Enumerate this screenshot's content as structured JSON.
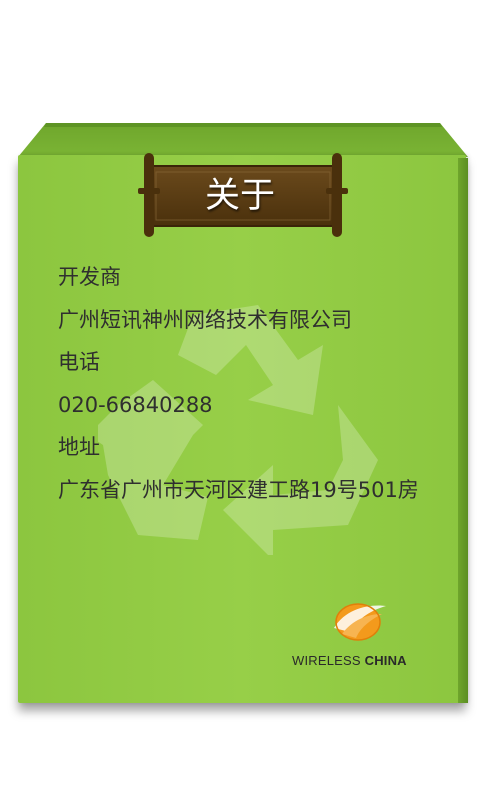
{
  "header": {
    "title": "关于"
  },
  "about": {
    "developer_label": "开发商",
    "developer_value": "广州短讯神州网络技术有限公司",
    "phone_label": "电话",
    "phone_value": "020-66840288",
    "address_label": "地址",
    "address_value": "广东省广州市天河区建工路19号501房"
  },
  "brand": {
    "name_light": "WIRELESS",
    "name_bold": "CHINA"
  },
  "colors": {
    "card_green": "#8cc63f",
    "banner_brown": "#5a3b12",
    "logo_orange": "#f39a1c"
  },
  "icons": {
    "watermark": "recycle-icon",
    "logo": "wireless-china-logo"
  }
}
